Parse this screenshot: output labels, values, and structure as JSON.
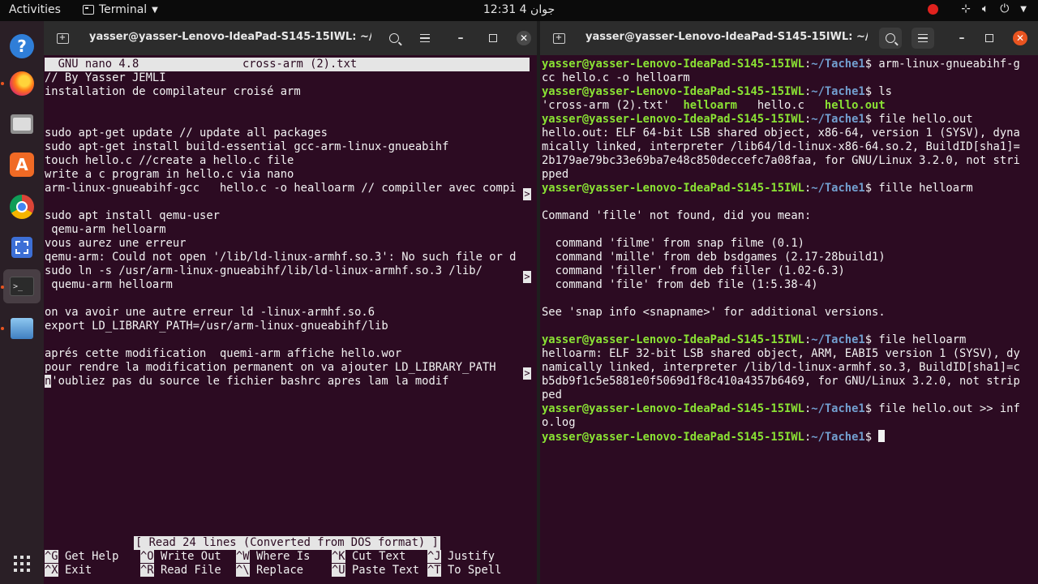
{
  "topbar": {
    "activities": "Activities",
    "app_name": "Terminal",
    "clock": "12:31 جوان 4"
  },
  "dock": {
    "items": [
      "help-icon",
      "firefox-icon",
      "files-icon",
      "software-store-icon",
      "chrome-icon",
      "screenshot-icon",
      "terminal-icon",
      "desktop-icon",
      "app-grid-icon"
    ]
  },
  "left_window": {
    "title": "yasser@yasser-Lenovo-IdeaPad-S145-15IWL: ~/Ta...",
    "nano_header_version": "  GNU nano 4.8",
    "nano_header_file": "cross-arm (2).txt",
    "lines": [
      "// By Yasser JEMLI",
      "installation de compilateur croisé arm",
      "",
      "",
      "sudo apt-get update // update all packages",
      "sudo apt-get install build-essential gcc-arm-linux-gnueabihf",
      "touch hello.c //create a hello.c file",
      "write a c program in hello.c via nano",
      "arm-linux-gnueabihf-gcc   hello.c -o healloarm // compiller avec compi",
      "",
      "sudo apt install qemu-user",
      " qemu-arm helloarm",
      "vous aurez une erreur",
      "qemu-arm: Could not open '/lib/ld-linux-armhf.so.3': No such file or d",
      "sudo ln -s /usr/arm-linux-gnueabihf/lib/ld-linux-armhf.so.3 /lib/",
      " quemu-arm helloarm",
      "",
      "on va avoir une autre erreur ld -linux-armhf.so.6",
      "export LD_LIBRARY_PATH=/usr/arm-linux-gnueabihf/lib",
      "",
      "aprés cette modification  quemi-arm affiche hello.wor",
      "pour rendre la modification permanent on va ajouter LD_LIBRARY_PATH"
    ],
    "last_line_first_char": "n",
    "last_line_rest": "'oubliez pas du source le fichier bashrc apres lam la modif",
    "truncation_marker": ">",
    "status_message": "[ Read 24 lines (Converted from DOS format) ]",
    "shortcuts": [
      {
        "key": "^G",
        "label": "Get Help"
      },
      {
        "key": "^O",
        "label": "Write Out"
      },
      {
        "key": "^W",
        "label": "Where Is"
      },
      {
        "key": "^K",
        "label": "Cut Text"
      },
      {
        "key": "^J",
        "label": "Justify"
      },
      {
        "key": "^X",
        "label": "Exit"
      },
      {
        "key": "^R",
        "label": "Read File"
      },
      {
        "key": "^\\",
        "label": "Replace"
      },
      {
        "key": "^U",
        "label": "Paste Text"
      },
      {
        "key": "^T",
        "label": "To Spell"
      }
    ]
  },
  "right_window": {
    "title": "yasser@yasser-Lenovo-IdeaPad-S145-15IWL: ~/Ta...",
    "prompt_user": "yasser@yasser-Lenovo-IdeaPad-S145-15IWL",
    "prompt_path": "~/Tache1",
    "cmd1_a": "arm-linux-gnueabihf-g",
    "cmd1_b": "cc hello.c -o helloarm",
    "cmd2": "ls",
    "ls_1": "'cross-arm (2).txt'",
    "ls_2": "helloarm",
    "ls_3": "hello.c",
    "ls_4": "hello.out",
    "cmd3": "file hello.out",
    "out3": [
      "hello.out: ELF 64-bit LSB shared object, x86-64, version 1 (SYSV), dyna",
      "mically linked, interpreter /lib64/ld-linux-x86-64.so.2, BuildID[sha1]=",
      "2b179ae79bc33e69ba7e48c850deccefc7a08faa, for GNU/Linux 3.2.0, not stri",
      "pped"
    ],
    "cmd4": "fille helloarm",
    "out4": [
      "",
      "Command 'fille' not found, did you mean:",
      "",
      "  command 'filme' from snap filme (0.1)",
      "  command 'mille' from deb bsdgames (2.17-28build1)",
      "  command 'filler' from deb filler (1.02-6.3)",
      "  command 'file' from deb file (1:5.38-4)",
      "",
      "See 'snap info <snapname>' for additional versions.",
      ""
    ],
    "cmd5": "file helloarm",
    "out5": [
      "helloarm: ELF 32-bit LSB shared object, ARM, EABI5 version 1 (SYSV), dy",
      "namically linked, interpreter /lib/ld-linux-armhf.so.3, BuildID[sha1]=c",
      "b5db9f1c5e5881e0f5069d1f8c410a4357b6469, for GNU/Linux 3.2.0, not strip",
      "ped"
    ],
    "cmd6_a": "file hello.out >> inf",
    "cmd6_b": "o.log"
  }
}
